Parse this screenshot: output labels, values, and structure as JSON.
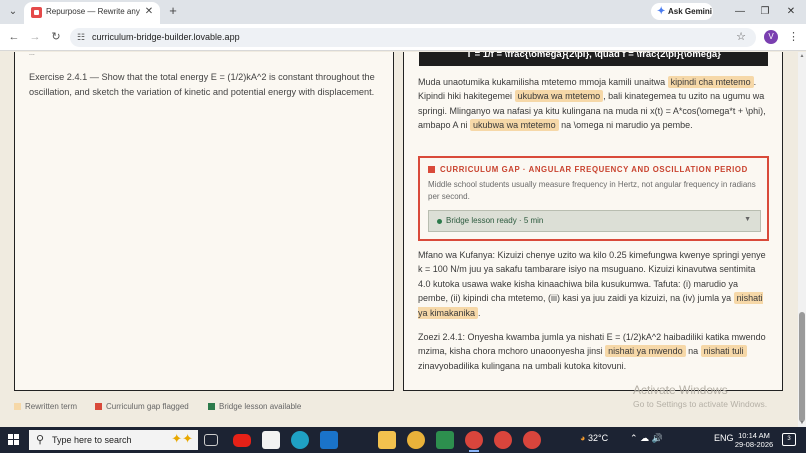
{
  "browser": {
    "tab_title": "Repurpose — Rewrite any lesso",
    "url": "curriculum-bridge-builder.lovable.app",
    "gemini_label": "Ask Gemini",
    "avatar_initial": "V"
  },
  "left_panel": {
    "fragment": "...",
    "exercise": "Exercise 2.4.1 — Show that the total energy E = (1/2)kA^2 is constant throughout the oscillation, and sketch the variation of kinetic and potential energy with displacement."
  },
  "right_panel": {
    "formula_fragment": "T = 1/f = \\frac{\\omega}{2\\pi}, \\quad f = \\frac{2\\pi}{\\omega}",
    "p1": [
      {
        "t": "Muda unaotumika kukamilisha mtetemo mmoja kamili unaitwa "
      },
      {
        "t": "kipindi cha mtetemo",
        "hl": true
      },
      {
        "t": ". Kipindi hiki hakitegemei "
      },
      {
        "t": "ukubwa wa mtetemo",
        "hl": true
      },
      {
        "t": ", bali kinategemea tu uzito na ugumu wa springi. Mlinganyo wa nafasi ya kitu kulingana na muda ni x(t) = A*cos(\\omega*t + \\phi), ambapo A ni "
      },
      {
        "t": "ukubwa wa mtetemo",
        "hl": true
      },
      {
        "t": " na \\omega ni marudio ya pembe."
      }
    ],
    "gap": {
      "title": "CURRICULUM GAP · ANGULAR FREQUENCY AND OSCILLATION PERIOD",
      "description": "Middle school students usually measure frequency in Hertz, not angular frequency in radians per second.",
      "bridge_label": "Bridge lesson ready · 5 min"
    },
    "p2": [
      {
        "t": "Mfano wa Kufanya: Kizuizi chenye uzito wa kilo 0.25 kimefungwa kwenye springi yenye k = 100 N/m juu ya sakafu tambarare isiyo na msuguano. Kizuizi kinavutwa sentimita 4.0 kutoka usawa wake kisha kinaachiwa bila kusukumwa. Tafuta: (i) marudio ya pembe, (ii) kipindi cha mtetemo, (iii) kasi ya juu zaidi ya kizuizi, na (iv) jumla ya "
      },
      {
        "t": "nishati ya kimakanika",
        "hl": true
      },
      {
        "t": "."
      }
    ],
    "p3": [
      {
        "t": "Zoezi 2.4.1: Onyesha kwamba jumla ya nishati E = (1/2)kA^2 haibadiliki katika mwendo mzima, kisha chora mchoro unaoonyesha jinsi "
      },
      {
        "t": "nishati ya mwendo",
        "hl": true
      },
      {
        "t": " na "
      },
      {
        "t": "nishati tuli",
        "hl": true
      },
      {
        "t": " zinavyobadilika kulingana na umbali kutoka kitovuni."
      }
    ]
  },
  "legend": {
    "rewritten": "Rewritten term",
    "gap": "Curriculum gap flagged",
    "bridge": "Bridge lesson available"
  },
  "colors": {
    "rewritten": "#f6d8a8",
    "gap": "#d94a3a",
    "bridge": "#2c7a4b"
  },
  "watermark": {
    "title": "Activate Windows",
    "subtitle": "Go to Settings to activate Windows."
  },
  "taskbar": {
    "search_placeholder": "Type here to search",
    "temperature": "32°C",
    "language": "ENG",
    "time": "10:14 AM",
    "date": "29-08-2026",
    "notification_count": "3"
  }
}
